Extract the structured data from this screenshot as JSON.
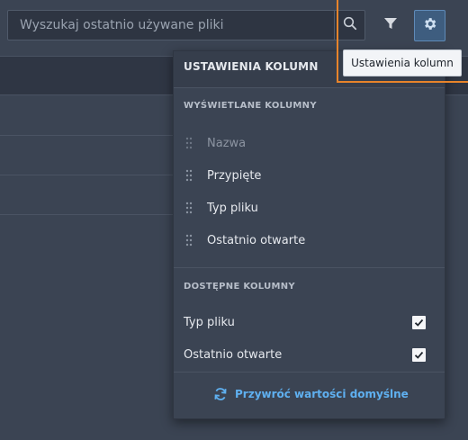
{
  "search": {
    "placeholder": "Wyszukaj ostatnio używane pliki",
    "value": ""
  },
  "toolbar": {
    "search_icon": "search-icon",
    "filter_icon": "filter-icon",
    "settings_icon": "gear-icon",
    "tooltip": "Ustawienia kolumn"
  },
  "panel": {
    "title": "USTAWIENIA KOLUMN",
    "displayed_section": "WYŚWIETLANE KOLUMNY",
    "displayed_columns": [
      {
        "label": "Nazwa",
        "disabled": true
      },
      {
        "label": "Przypięte",
        "disabled": false
      },
      {
        "label": "Typ pliku",
        "disabled": false
      },
      {
        "label": "Ostatnio otwarte",
        "disabled": false
      }
    ],
    "available_section": "DOSTĘPNE KOLUMNY",
    "available_columns": [
      {
        "label": "Typ pliku",
        "checked": true
      },
      {
        "label": "Ostatnio otwarte",
        "checked": true
      }
    ],
    "reset_label": "Przywróć wartości domyślne"
  },
  "colors": {
    "background": "#3b4453",
    "accent": "#5fb0f0",
    "highlight": "#e8842a",
    "settings_active": "#3e5d7f"
  }
}
